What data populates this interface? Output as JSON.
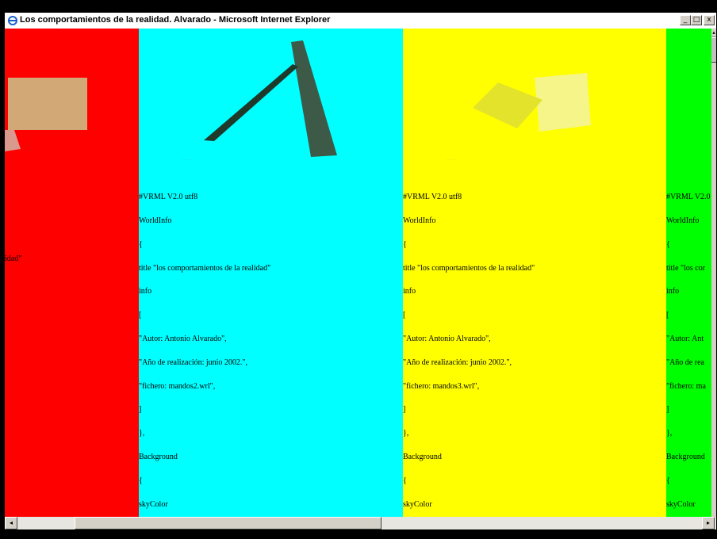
{
  "window": {
    "title": "Los comportamientos de la realidad. Alvarado - Microsoft Internet Explorer",
    "buttons": {
      "minimize": "_",
      "maximize": "□",
      "close": "x"
    }
  },
  "colors": {
    "red_panel": "#ff0000",
    "cyan_panel": "#00ffff",
    "yellow_panel": "#ffff00",
    "green_panel": "#00ff00"
  },
  "red_panel": {
    "fragment": "idad\""
  },
  "cyan_panel": {
    "lines": [
      "#VRML V2.0 utf8",
      "WorldInfo",
      "{",
      "title \"los comportamientos de la realidad\"",
      "info",
      "[",
      "\"Autor: Antonio Alvarado\",",
      "\"Año de realización: junio 2002.\",",
      "\"fichero: mandos2.wrl\",",
      "]",
      "},",
      "Background",
      "{",
      "skyColor",
      "["
    ]
  },
  "yellow_panel": {
    "lines": [
      "#VRML V2.0 utf8",
      "WorldInfo",
      "{",
      "title \"los comportamientos de la realidad\"",
      "info",
      "[",
      "\"Autor: Antonio Alvarado\",",
      "\"Año de realización: junio 2002.\",",
      "\"fichero: mandos3.wrl\",",
      "]",
      "},",
      "Background",
      "{",
      "skyColor",
      "["
    ]
  },
  "green_panel": {
    "lines": [
      "#VRML V2.0",
      "WorldInfo",
      "{",
      "title \"los cor",
      "info",
      "[",
      "\"Autor: Ant",
      "\"Año de rea",
      "\"fichero: ma",
      "]",
      "},",
      "Background",
      "{",
      "skyColor",
      "["
    ]
  },
  "scrollbars": {
    "left_arrow": "◂",
    "right_arrow": "▸",
    "up_arrow": "▴"
  }
}
